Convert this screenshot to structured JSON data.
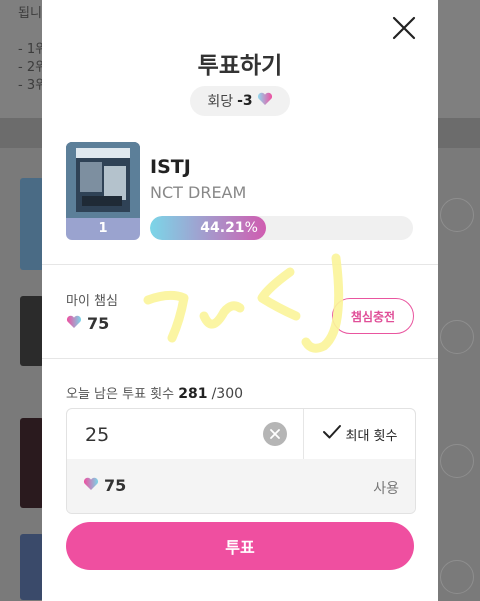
{
  "background": {
    "top_lines": [
      "됩니",
      "- 1위",
      "- 2위",
      "- 3위"
    ]
  },
  "modal": {
    "title": "투표하기",
    "per_round_label": "회당",
    "per_round_value": "-3",
    "close_icon": "close-icon",
    "rank": "1",
    "song_title": "ISTJ",
    "artist": "NCT DREAM",
    "vote_percent": 44.21,
    "vote_percent_number": "44.21",
    "vote_percent_unit": "%",
    "my_label": "마이 챔심",
    "my_value": "75",
    "charge_button": "챔심충전",
    "remaining_label": "오늘 남은 투표 횟수",
    "remaining_count": "281",
    "remaining_total": "/300",
    "input_value": "25",
    "max_button": "최대 횟수",
    "use_value": "75",
    "use_label": "사용",
    "vote_button": "투표"
  },
  "colors": {
    "accent_pink": "#ef4fa0",
    "gradient_start": "#7bd6e8",
    "gradient_end": "#d05cb0"
  }
}
